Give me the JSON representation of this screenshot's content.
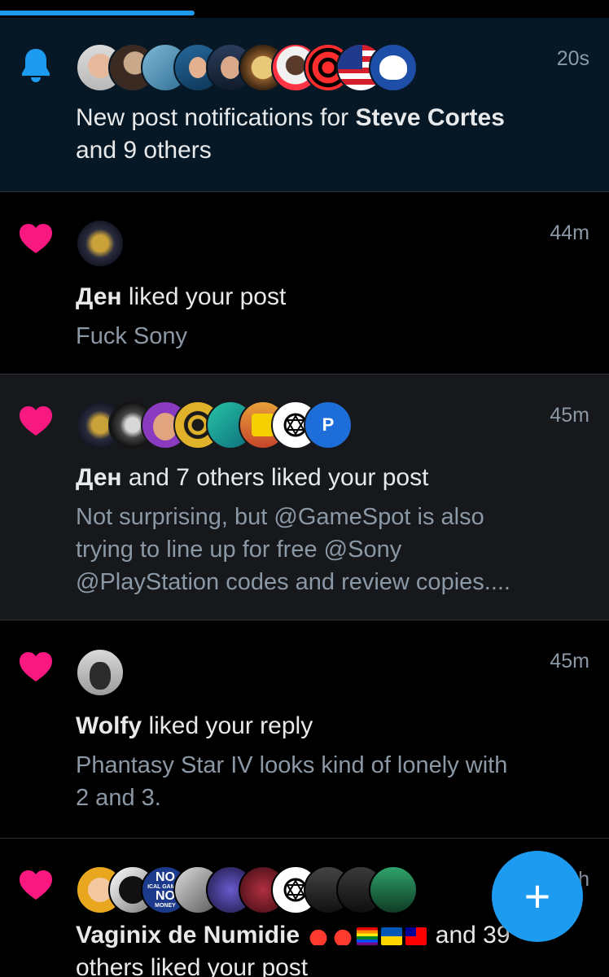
{
  "colors": {
    "accent": "#1d9bf0",
    "like": "#f91880",
    "text": "#e7e9ea",
    "muted": "#8b98a5"
  },
  "loading_progress": 0.32,
  "notifications": [
    {
      "type": "bell-icon",
      "time": "20s",
      "text_pre": "New post notifications for ",
      "actor": "Steve Cortes",
      "text_post_1": "and 9 others",
      "avatars": 10
    },
    {
      "type": "heart-icon",
      "time": "44m",
      "actor": "Ден",
      "action": " liked your post",
      "preview": "Fuck Sony",
      "avatars": 1
    },
    {
      "type": "heart-icon",
      "time": "45m",
      "actor": "Ден",
      "action": " and 7 others liked your post",
      "preview_1": "Not surprising, but @GameSpot is also",
      "preview_2": "trying to line up for free @Sony",
      "preview_3": "@PlayStation codes and review copies....",
      "avatars": 8,
      "last_avatar_letter": "P"
    },
    {
      "type": "heart-icon",
      "time": "45m",
      "actor": "Wolfy",
      "action": " liked your reply",
      "preview_1": "Phantasy Star IV looks kind of lonely with",
      "preview_2": "2 and 3.",
      "avatars": 1
    },
    {
      "type": "heart-icon",
      "time": "h",
      "actor": "Vaginix de Numidie",
      "action_tail": " and 39",
      "action_line2": "others liked your post",
      "avatars": 10,
      "avatar_badge_line1": "NO",
      "avatar_badge_line2": "NO",
      "avatar_badge_small_1": "ICAL GAMES",
      "avatar_badge_small_2": "MONEY"
    }
  ],
  "fab": {
    "label": "+"
  }
}
